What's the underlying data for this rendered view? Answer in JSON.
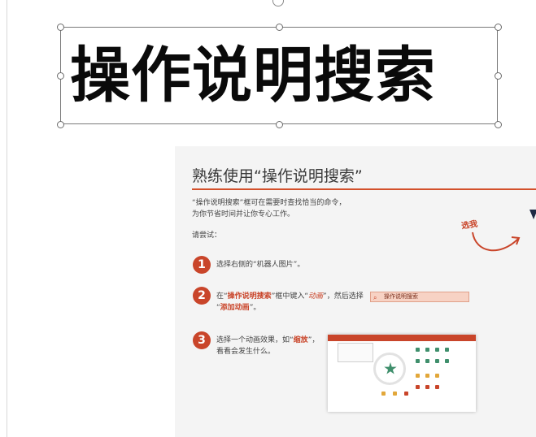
{
  "title_text": "操作说明搜索",
  "slide": {
    "title": "熟练使用“操作说明搜索”",
    "intro_line1": "“操作说明搜索”框可在需要时查找恰当的命令，",
    "intro_line2": "为你节省时间并让你专心工作。",
    "try_label": "请尝试：",
    "tryme_label": "选我",
    "steps": [
      {
        "num": "1",
        "text": "选择右侧的“机器人图片”。"
      },
      {
        "num": "2",
        "pre": "在“",
        "hl1": "操作说明搜索",
        "mid": "”框中键入“",
        "hl2": "动画",
        "post": "”，然后选择",
        "line2_pre": "“",
        "line2_hl": "添加动画",
        "line2_post": "”。"
      },
      {
        "num": "3",
        "pre": "选择一个动画效果，如“",
        "hl1": "缩放",
        "post": "”，",
        "line2": "看看会发生什么。"
      }
    ],
    "search_demo_label": "操作说明搜索"
  },
  "colors": {
    "accent": "#c9452a",
    "rule": "#d3502b"
  }
}
